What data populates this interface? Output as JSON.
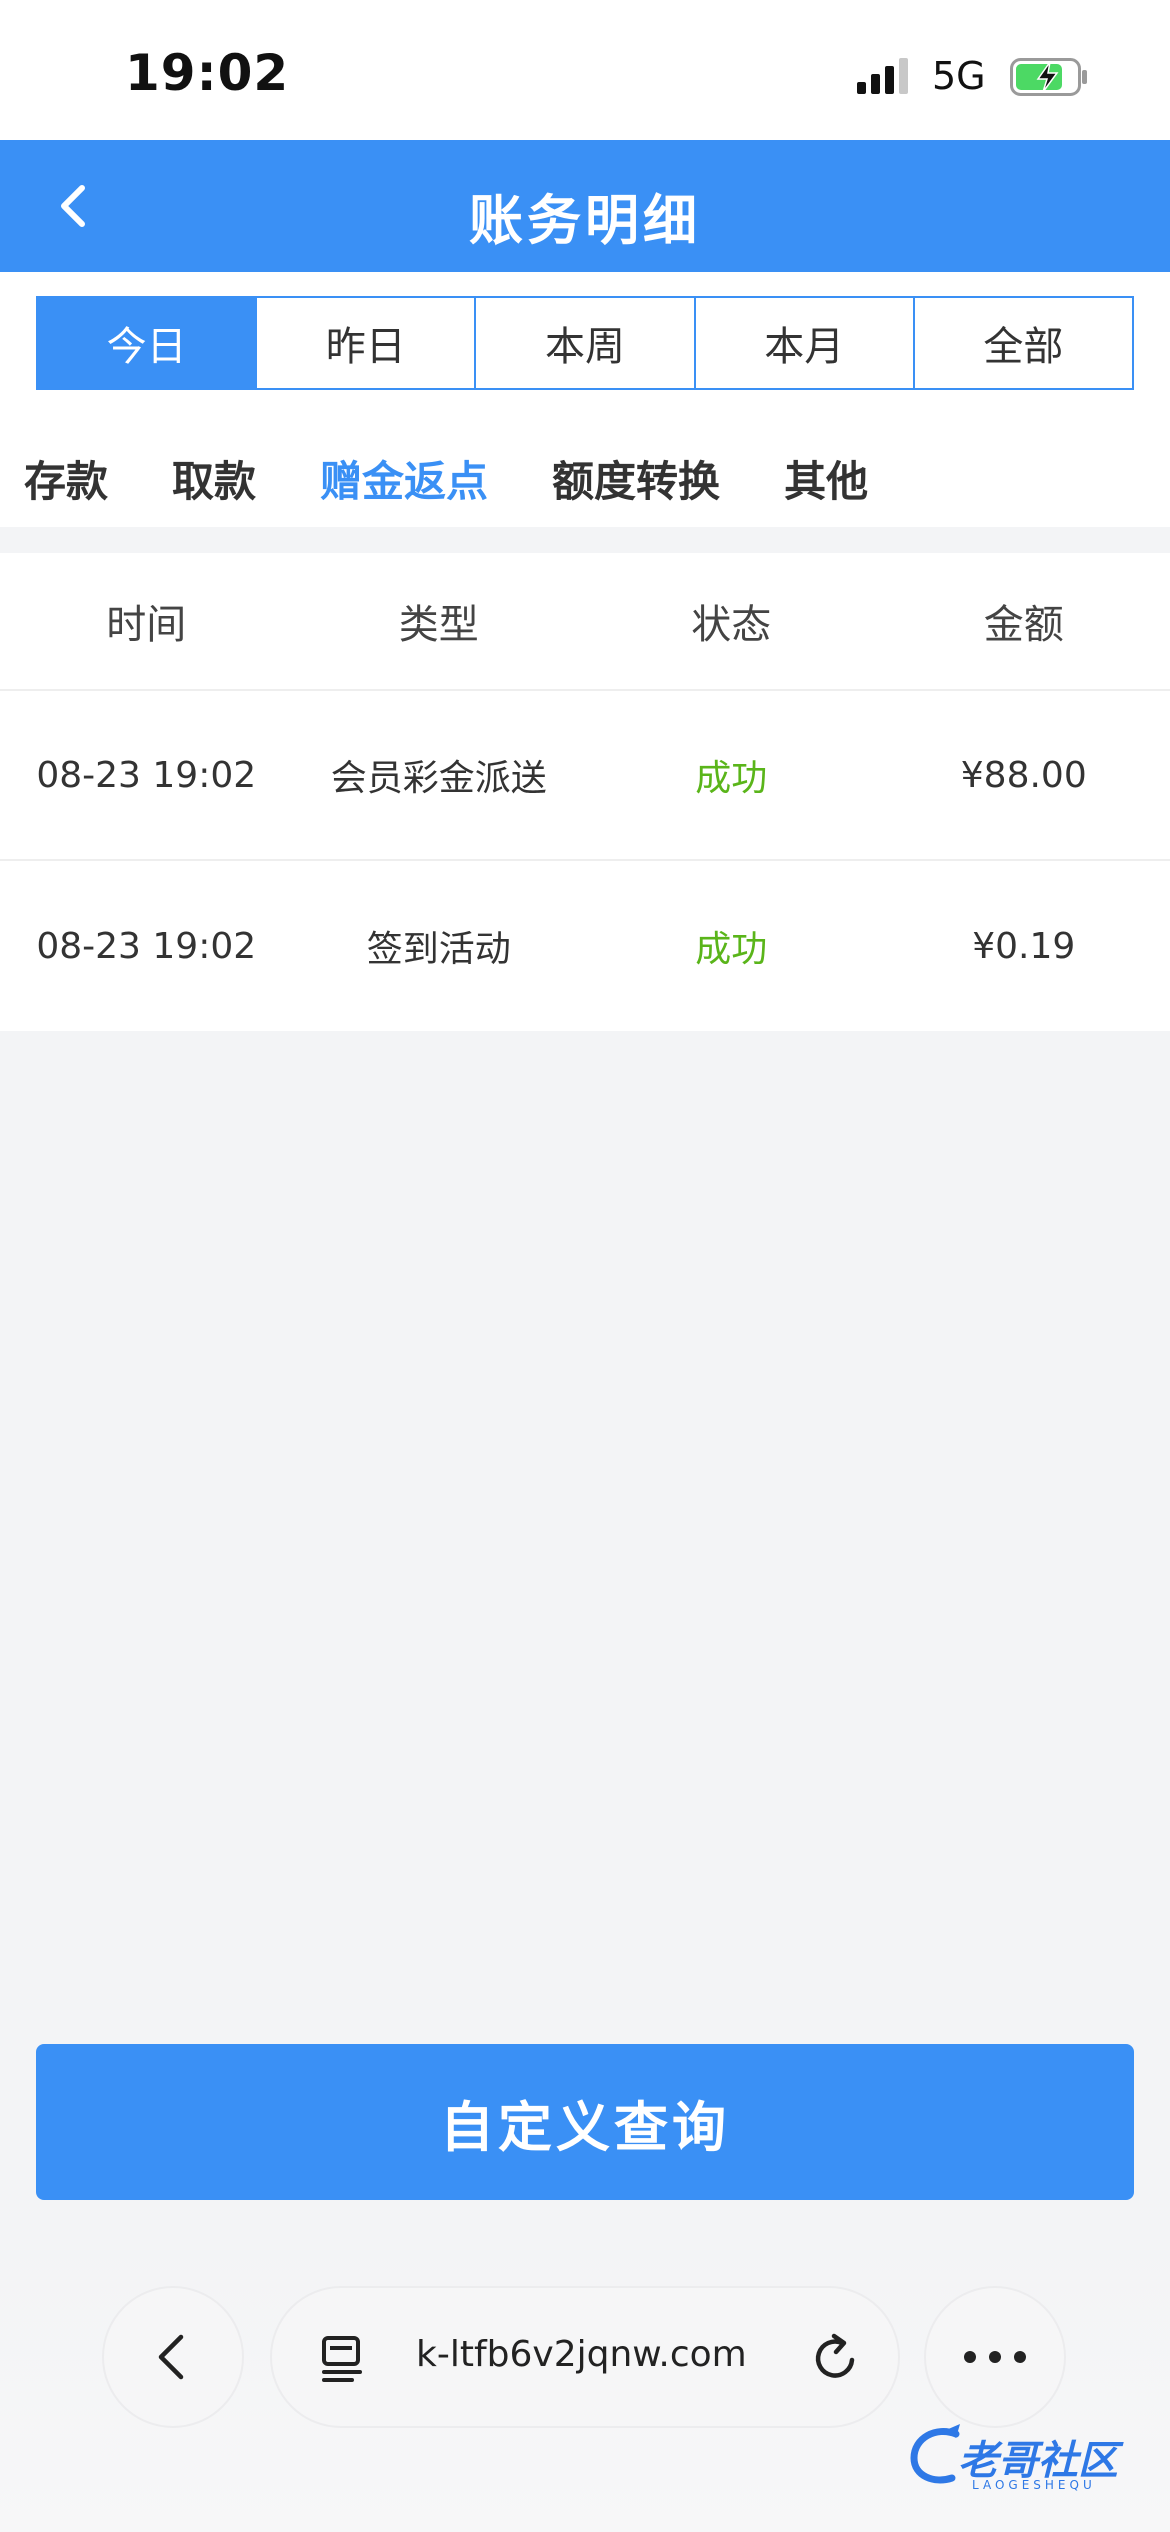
{
  "status_bar": {
    "time": "19:02",
    "network": "5G"
  },
  "nav": {
    "title": "账务明细"
  },
  "date_ranges": [
    {
      "label": "今日",
      "active": true
    },
    {
      "label": "昨日",
      "active": false
    },
    {
      "label": "本周",
      "active": false
    },
    {
      "label": "本月",
      "active": false
    },
    {
      "label": "全部",
      "active": false
    }
  ],
  "categories": [
    {
      "label": "存款",
      "active": false
    },
    {
      "label": "取款",
      "active": false
    },
    {
      "label": "赠金返点",
      "active": true
    },
    {
      "label": "额度转换",
      "active": false
    },
    {
      "label": "其他",
      "active": false
    }
  ],
  "table": {
    "headers": [
      "时间",
      "类型",
      "状态",
      "金额"
    ],
    "rows": [
      {
        "time": "08-23 19:02",
        "type": "会员彩金派送",
        "status": "成功",
        "amount": "¥88.00"
      },
      {
        "time": "08-23 19:02",
        "type": "签到活动",
        "status": "成功",
        "amount": "¥0.19"
      }
    ]
  },
  "query_button": {
    "label": "自定义查询"
  },
  "browser": {
    "url": "k-ltfb6v2jqnw.com"
  },
  "watermark": {
    "text": "老哥社区",
    "sub": "LAOGESHEQU"
  },
  "colors": {
    "accent": "#3a90f5",
    "success": "#5ab51a",
    "battery": "#4cd964"
  },
  "icons": [
    "signal-icon",
    "battery-icon",
    "back-icon",
    "chevron-left-icon",
    "tabs-icon",
    "reload-icon",
    "more-icon"
  ]
}
